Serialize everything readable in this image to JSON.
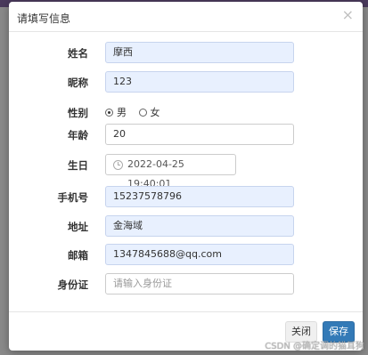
{
  "dialog": {
    "title": "请填写信息",
    "close_glyph": "×"
  },
  "form": {
    "name": {
      "label": "姓名",
      "value": "摩西"
    },
    "nickname": {
      "label": "昵称",
      "value": "123"
    },
    "gender": {
      "label": "性别",
      "options": [
        {
          "label": "男",
          "checked": true
        },
        {
          "label": "女",
          "checked": false
        }
      ]
    },
    "age": {
      "label": "年龄",
      "value": "20"
    },
    "birthday": {
      "label": "生日",
      "value": "2022-04-25 19:40:01",
      "icon": "clock-icon"
    },
    "phone": {
      "label": "手机号",
      "value": "15237578796"
    },
    "address": {
      "label": "地址",
      "value": "金海域"
    },
    "email": {
      "label": "邮箱",
      "value": "1347845688@qq.com"
    },
    "id_card": {
      "label": "身份证",
      "value": "",
      "placeholder": "请输入身份证"
    }
  },
  "footer": {
    "close_label": "关闭",
    "save_label": "保存"
  },
  "watermark": "CSDN @确定调的猫耳狗",
  "colors": {
    "autofill_bg": "#e8f0fe",
    "primary": "#337ab7"
  }
}
